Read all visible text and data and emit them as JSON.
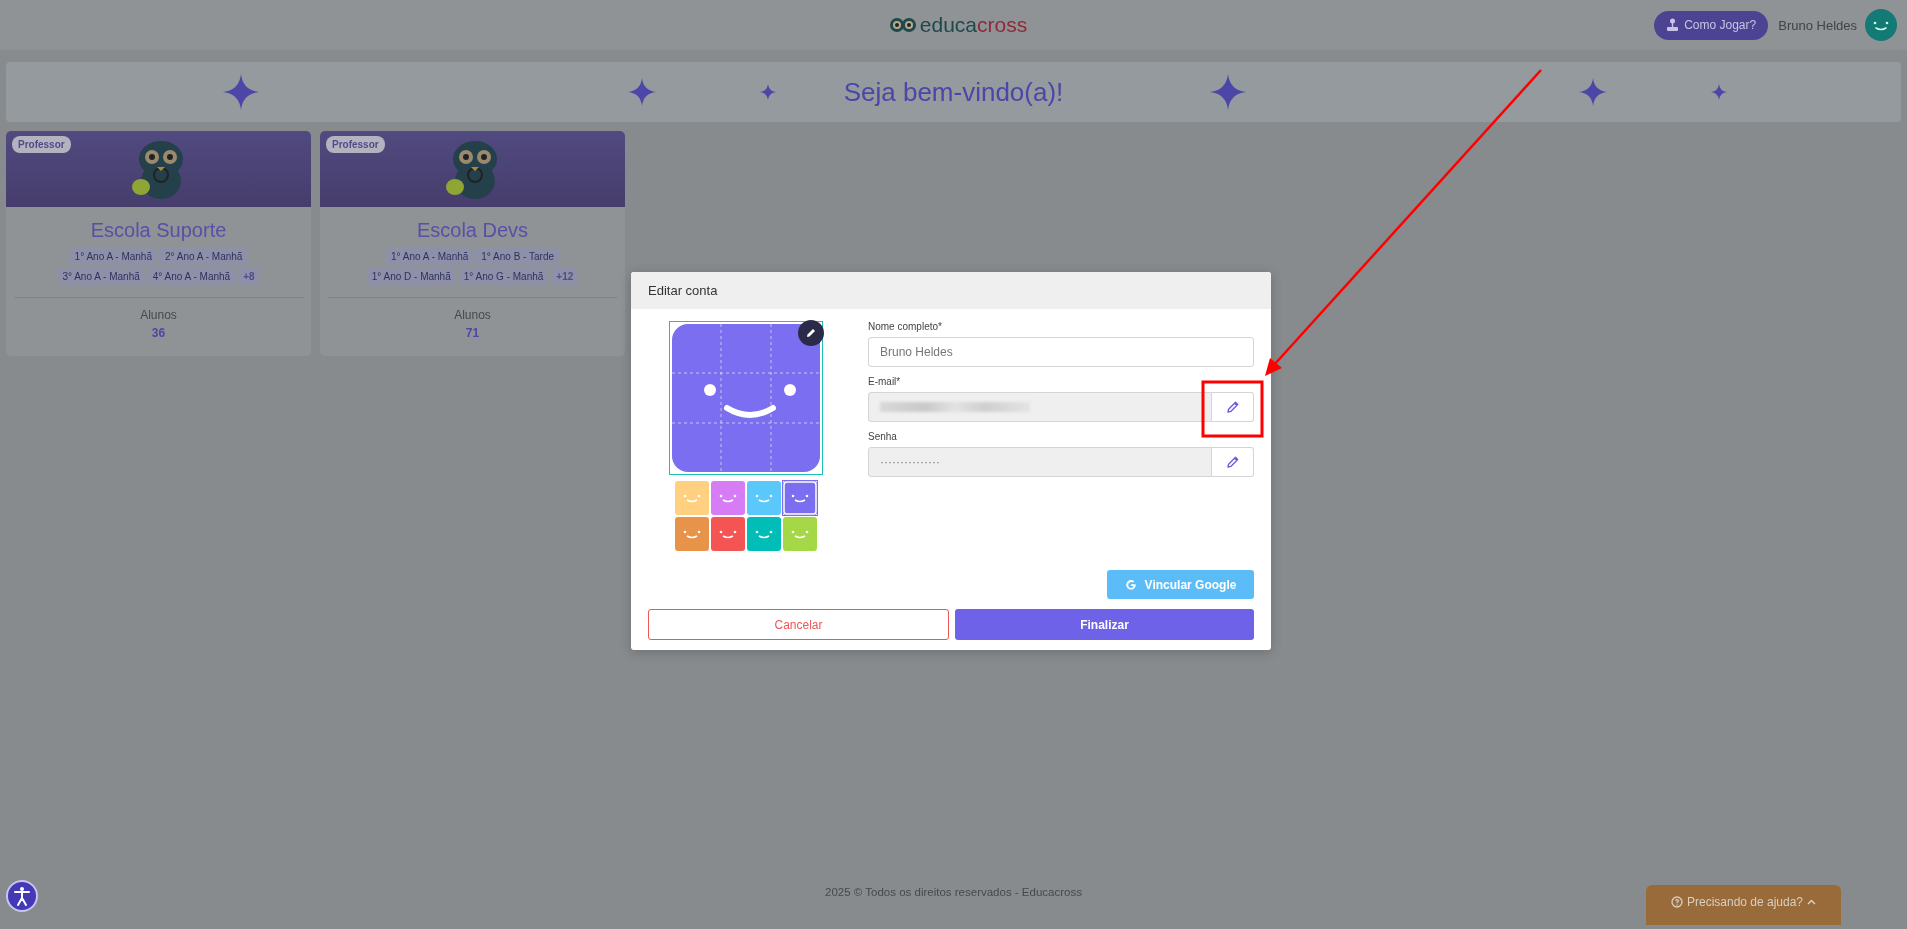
{
  "header": {
    "logo": {
      "part_1": "educa",
      "part_2": "cross"
    },
    "help_button": "Como Jogar?",
    "user_name": "Bruno Heldes"
  },
  "banner": {
    "title": "Seja bem-vindo(a)!"
  },
  "schools": [
    {
      "role": "Professor",
      "name": "Escola Suporte",
      "classes": [
        "1° Ano A - Manhã",
        "2° Ano A - Manhã",
        "3° Ano A - Manhã",
        "4° Ano A - Manhã"
      ],
      "more": "+8",
      "students_label": "Alunos",
      "students": "36"
    },
    {
      "role": "Professor",
      "name": "Escola Devs",
      "classes": [
        "1° Ano A - Manhã",
        "1° Ano B - Tarde",
        "1° Ano D - Manhã",
        "1° Ano G - Manhã"
      ],
      "more": "+12",
      "students_label": "Alunos",
      "students": "71"
    }
  ],
  "modal": {
    "title": "Editar conta",
    "avatar_colors": [
      {
        "color": "#ffd080",
        "selected": false
      },
      {
        "color": "#d67cf5",
        "selected": false
      },
      {
        "color": "#5bc8fb",
        "selected": false
      },
      {
        "color": "#7b6ef0",
        "selected": true
      },
      {
        "color": "#e8934a",
        "selected": false
      },
      {
        "color": "#f55454",
        "selected": false
      },
      {
        "color": "#00bdb7",
        "selected": false
      },
      {
        "color": "#a4d846",
        "selected": false
      }
    ],
    "fields": [
      {
        "kind": "text",
        "label": "Nome completo*",
        "value": "Bruno Heldes",
        "disabled": false
      },
      {
        "kind": "blurred",
        "label": "E-mail*",
        "disabled": true
      },
      {
        "kind": "password",
        "label": "Senha",
        "value": "···············",
        "disabled": true
      }
    ],
    "google_button": "Vincular Google",
    "cancel_button": "Cancelar",
    "submit_button": "Finalizar"
  },
  "footer": "2025 © Todos os direitos reservados - Educacross",
  "help_widget": "Precisando de ajuda?"
}
